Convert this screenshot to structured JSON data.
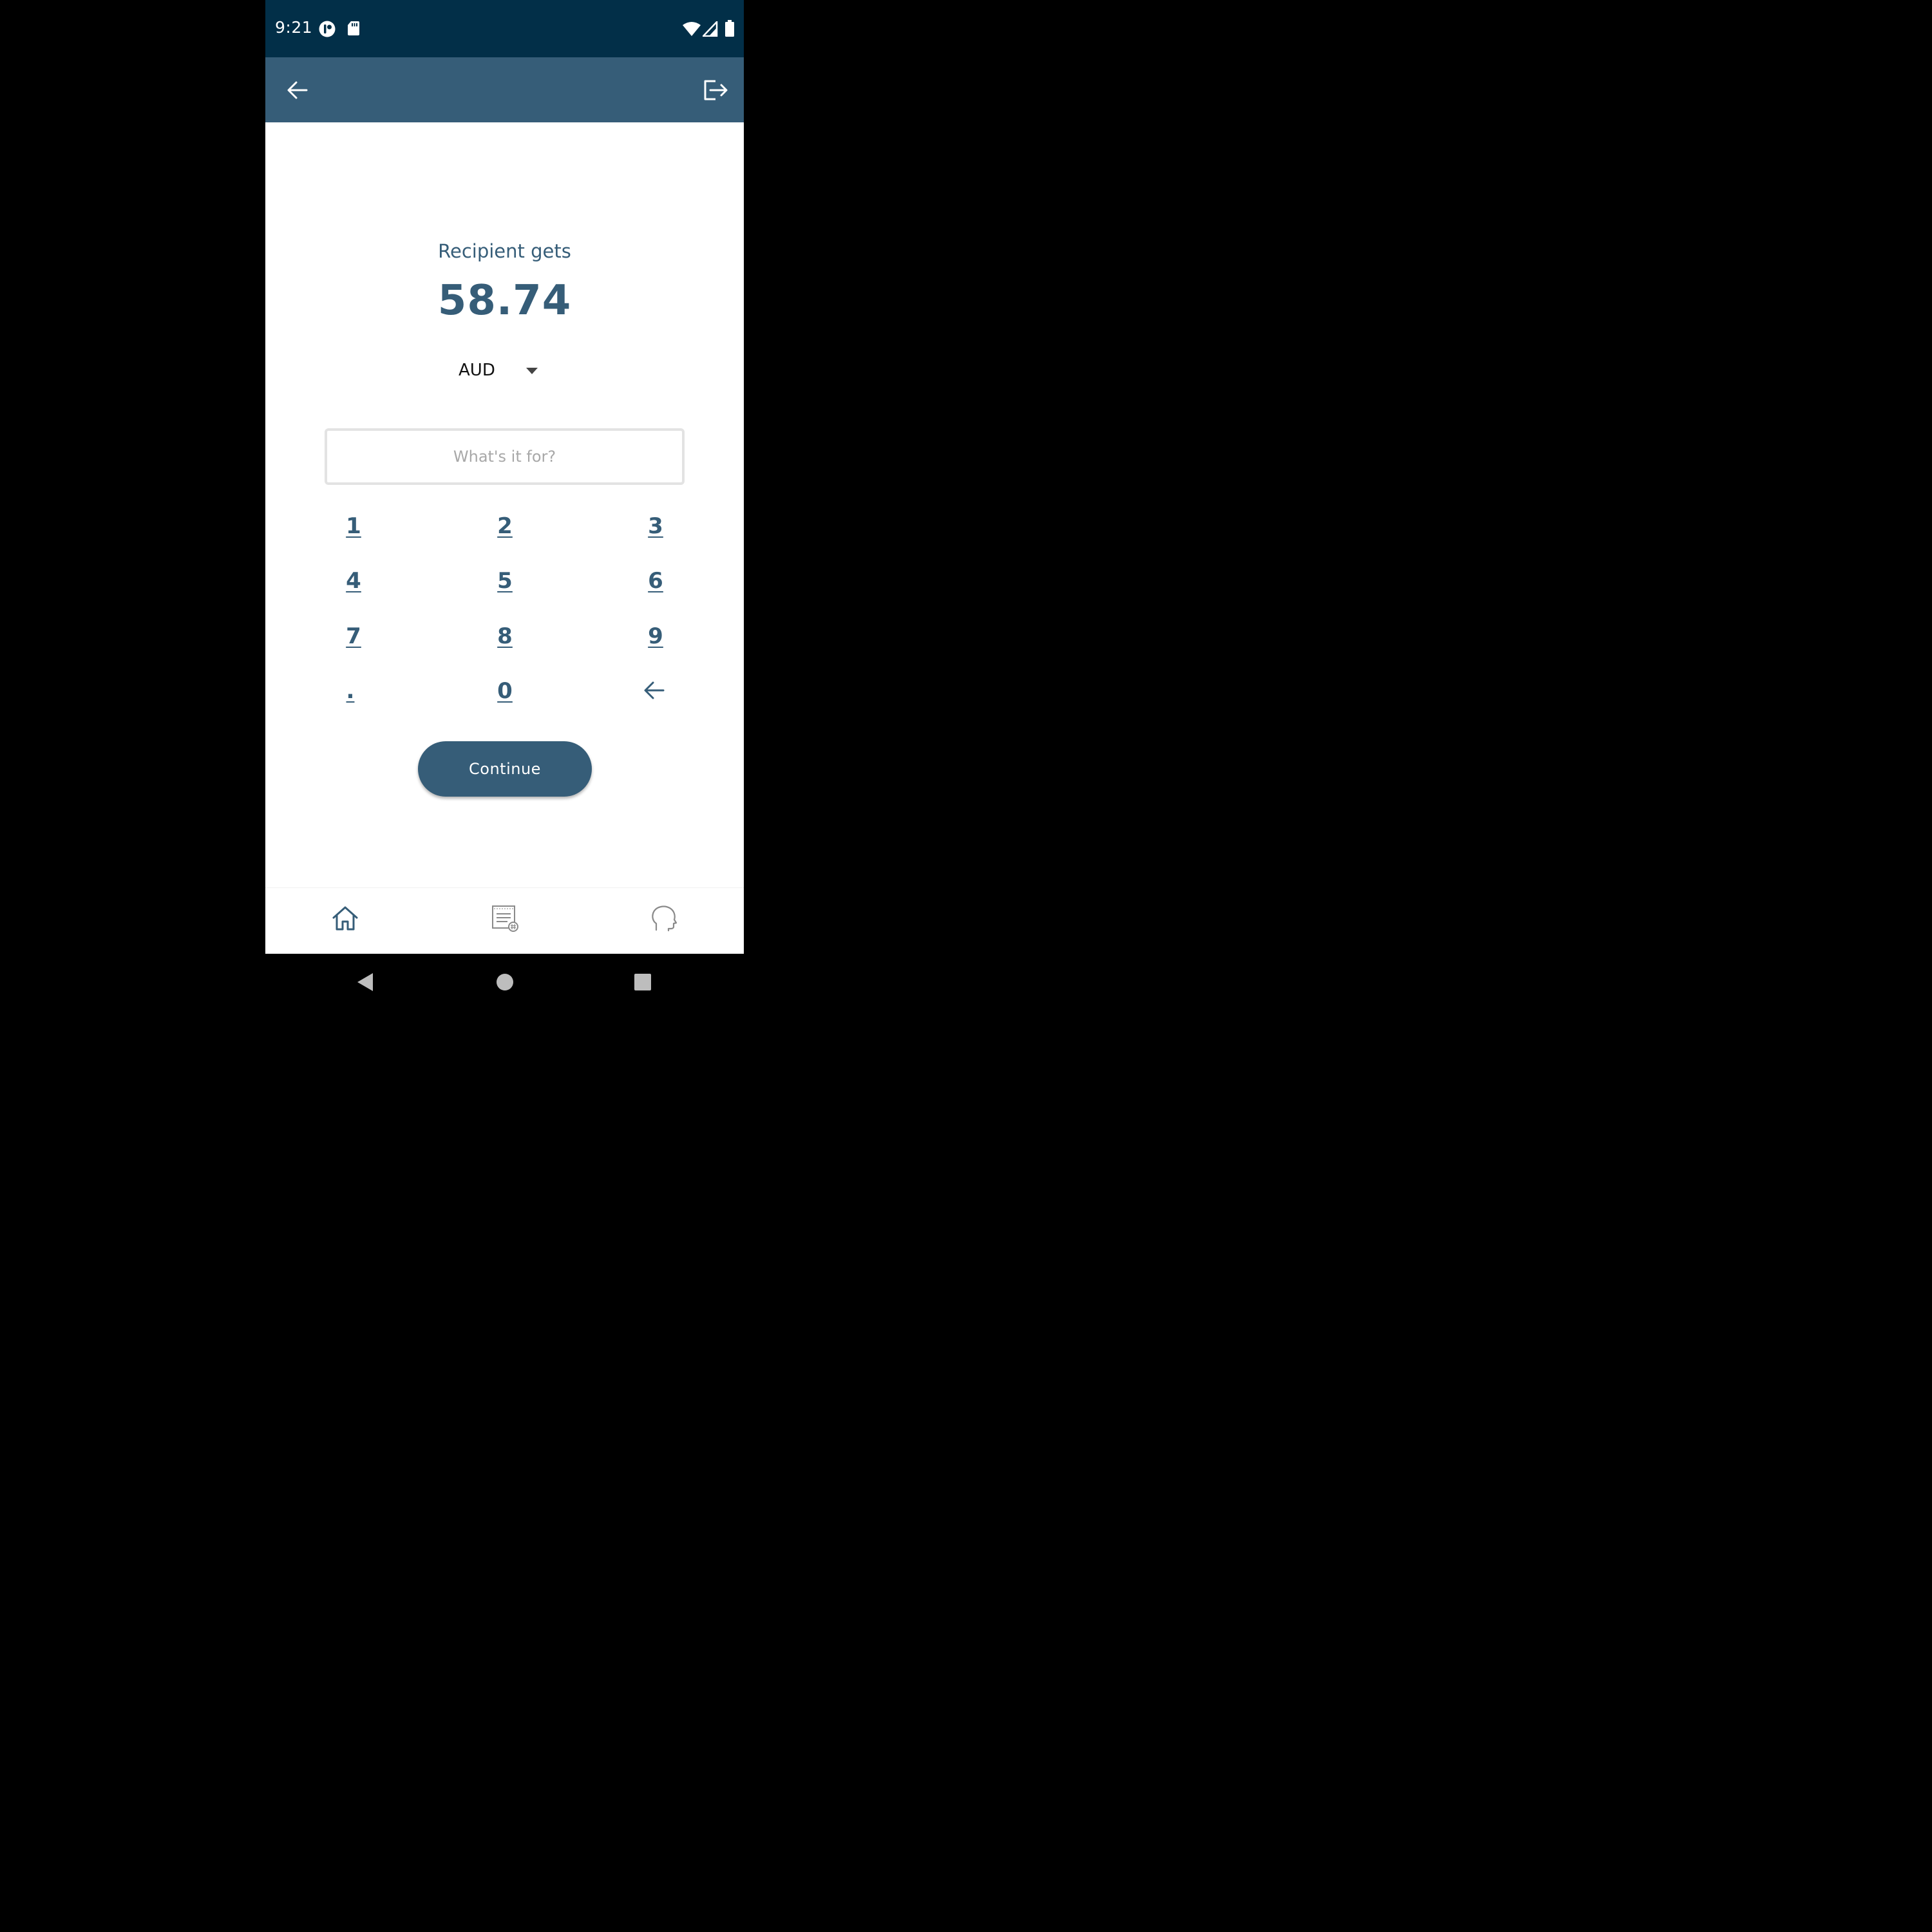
{
  "status_bar": {
    "time": "9:21"
  },
  "app_bar": {
    "back_icon": "arrow-left-icon",
    "logout_icon": "logout-icon"
  },
  "transfer": {
    "label": "Recipient gets",
    "amount": "58.74",
    "currency": "AUD",
    "memo_placeholder": "What's it for?",
    "memo_value": ""
  },
  "keypad": {
    "keys": [
      "1",
      "2",
      "3",
      "4",
      "5",
      "6",
      "7",
      "8",
      "9",
      ".",
      "0"
    ],
    "backspace_icon": "backspace-arrow-icon"
  },
  "continue_label": "Continue",
  "bottom_nav": {
    "items": [
      "home-icon",
      "transactions-icon",
      "support-icon"
    ]
  },
  "colors": {
    "status_bar": "#022f48",
    "primary": "#365d78",
    "input_border": "#e3e3e3",
    "placeholder": "#a8a8a8"
  }
}
